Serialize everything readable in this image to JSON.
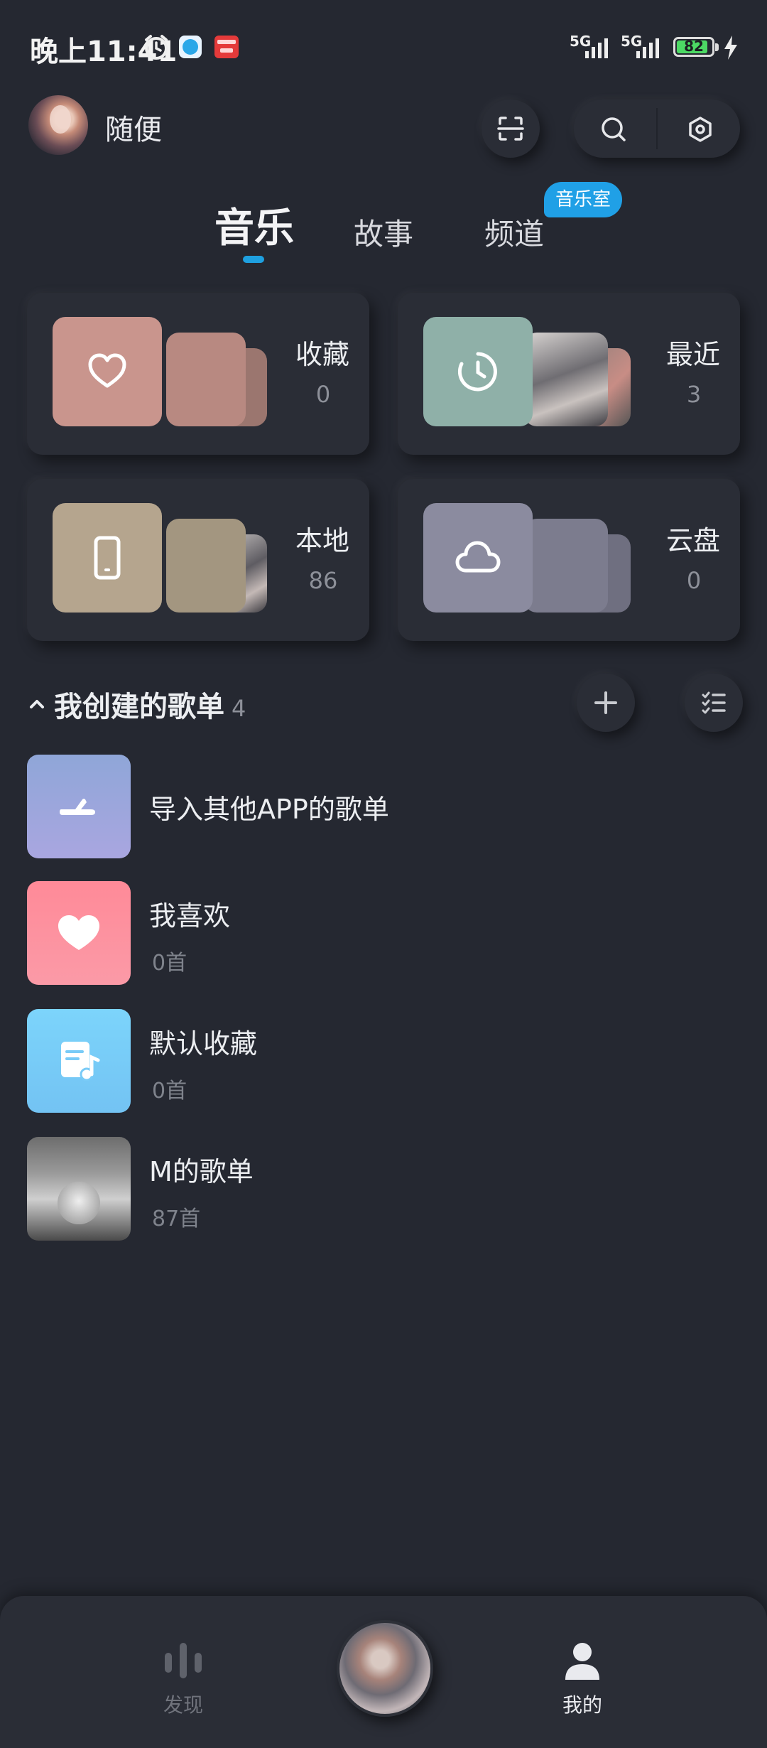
{
  "status_bar": {
    "time": "晚上11:41",
    "network_1": "5G",
    "network_2": "5G",
    "battery_level": "82"
  },
  "header": {
    "username": "随便"
  },
  "tabs": [
    {
      "label": "音乐",
      "active": true
    },
    {
      "label": "故事",
      "active": false
    },
    {
      "label": "频道",
      "active": false
    }
  ],
  "tab_badge": "音乐室",
  "cards": [
    {
      "title": "收藏",
      "count": "0",
      "icon": "heart-icon",
      "color": "#c9958d"
    },
    {
      "title": "最近",
      "count": "3",
      "icon": "clock-icon",
      "color": "#8fb0a8"
    },
    {
      "title": "本地",
      "count": "86",
      "icon": "phone-icon",
      "color": "#b5a58e"
    },
    {
      "title": "云盘",
      "count": "0",
      "icon": "cloud-icon",
      "color": "#8b8b9f"
    }
  ],
  "section": {
    "title": "我创建的歌单",
    "count": "4"
  },
  "playlists": [
    {
      "title": "导入其他APP的歌单",
      "subtitle": "",
      "icon": "import-icon"
    },
    {
      "title": "我喜欢",
      "subtitle": "0首",
      "icon": "heart-icon"
    },
    {
      "title": "默认收藏",
      "subtitle": "0首",
      "icon": "music-note-doc-icon"
    },
    {
      "title": "M的歌单",
      "subtitle": "87首",
      "icon": "photo-cover"
    }
  ],
  "bottom_nav": [
    {
      "label": "发现",
      "icon": "sound-bars-icon",
      "active": false
    },
    {
      "label": "我的",
      "icon": "person-icon",
      "active": true
    }
  ],
  "colors": {
    "background": "#252831",
    "accent": "#1ea0e0"
  }
}
